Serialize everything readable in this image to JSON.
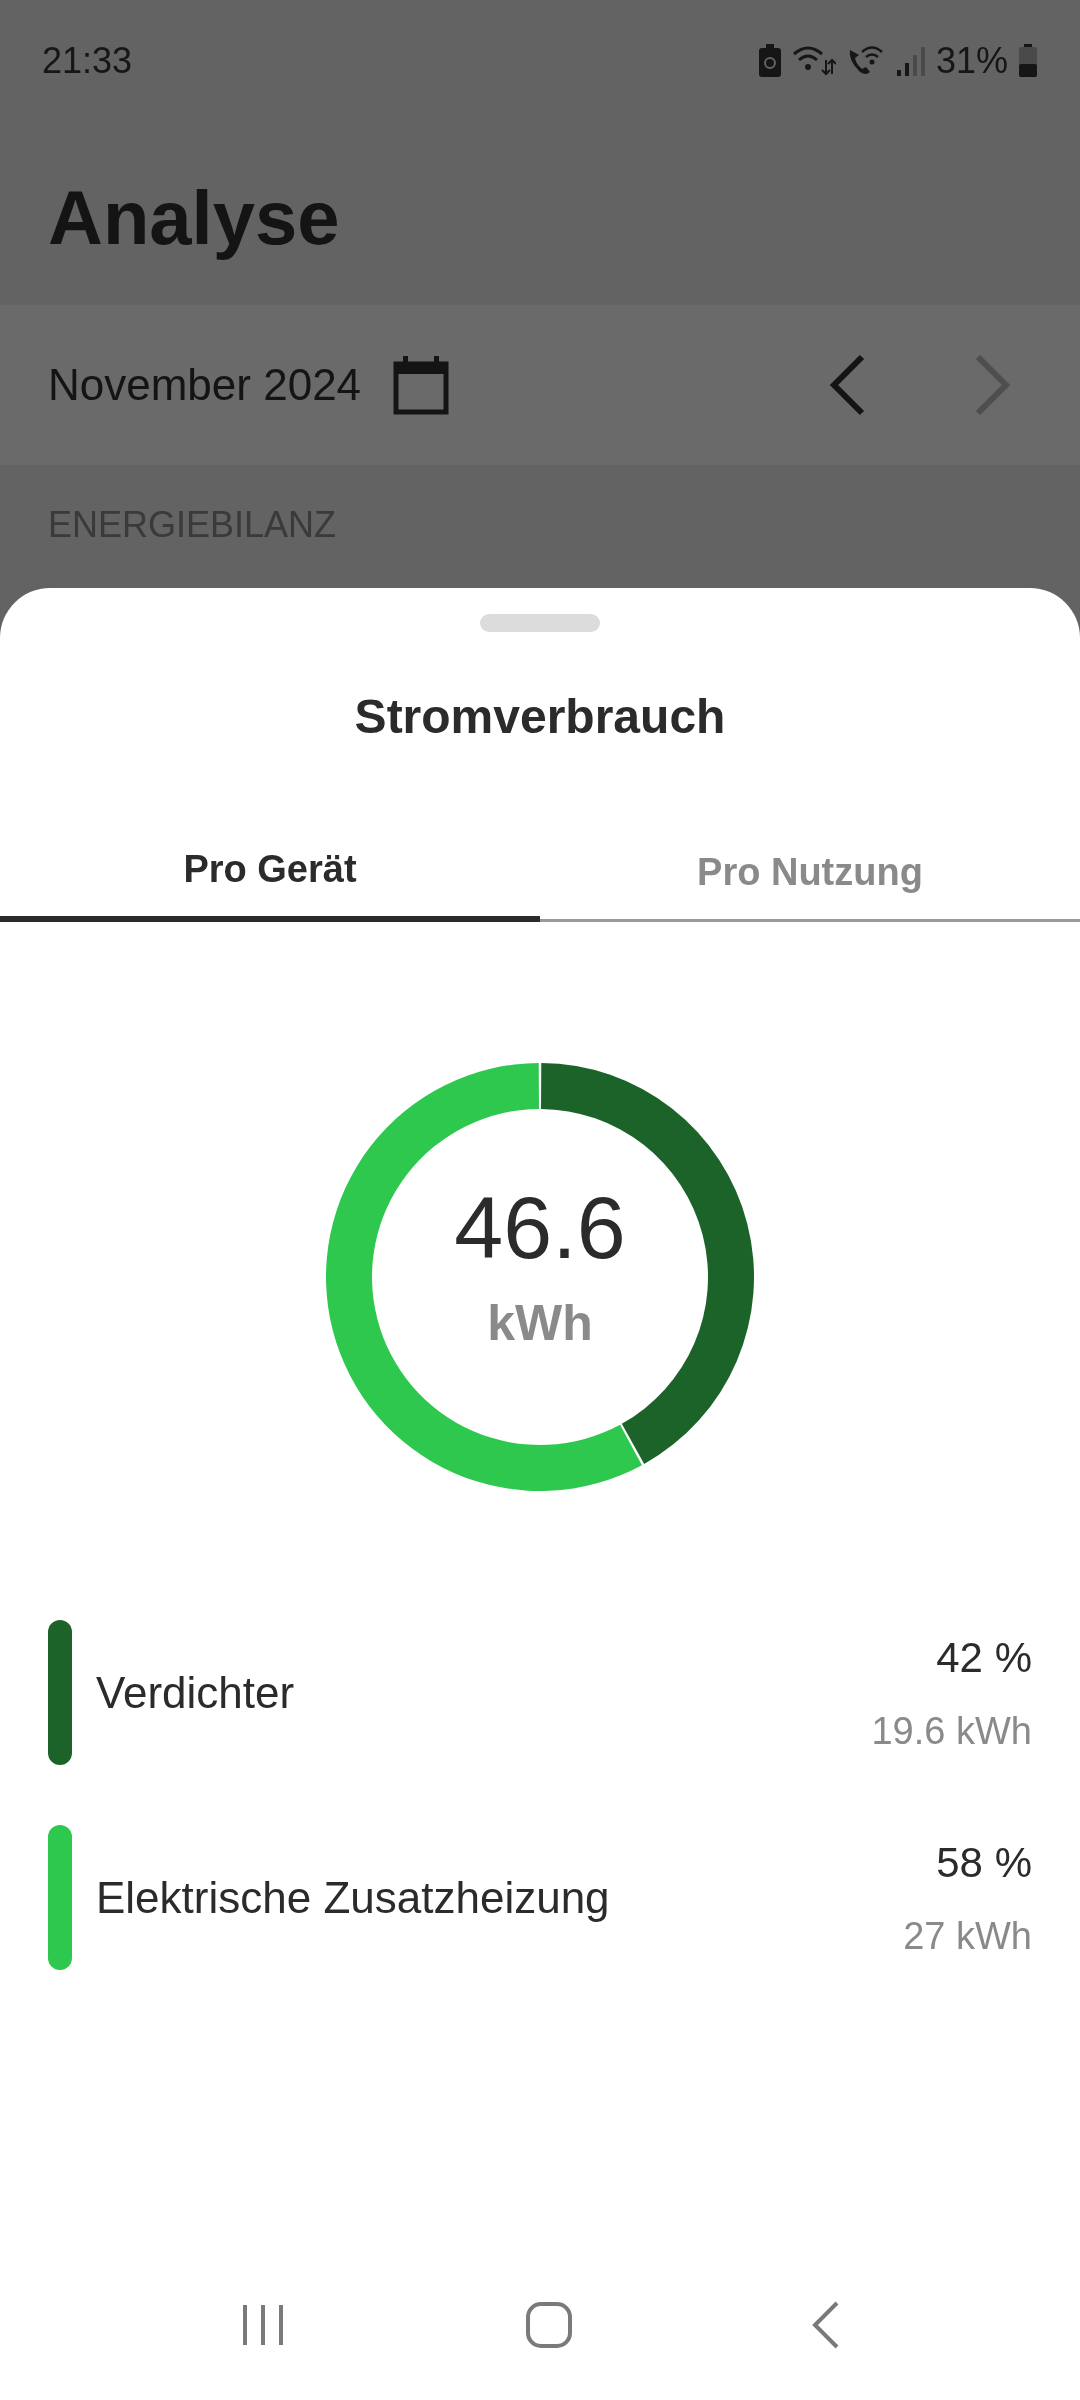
{
  "status_bar": {
    "time": "21:33",
    "battery": "31%"
  },
  "header": {
    "title": "Analyse"
  },
  "period": {
    "label": "November 2024",
    "prev_enabled": true,
    "next_enabled": false
  },
  "section": {
    "label": "ENERGIEBILANZ"
  },
  "sheet": {
    "title": "Stromverbrauch",
    "tabs": [
      {
        "label": "Pro Gerät",
        "selected": true
      },
      {
        "label": "Pro Nutzung",
        "selected": false
      }
    ],
    "total": {
      "value": "46.6",
      "unit": "kWh"
    },
    "chart_data": {
      "type": "donut",
      "categories": [
        "Verdichter",
        "Elektrische Zusatzheizung"
      ],
      "values": [
        42,
        58
      ]
    },
    "legend": [
      {
        "color": "#1b6329",
        "percent": "42 %",
        "energy": "19.6 kWh"
      },
      {
        "color": "#2dc84d",
        "percent": "58 %",
        "energy": "27 kWh"
      }
    ]
  }
}
